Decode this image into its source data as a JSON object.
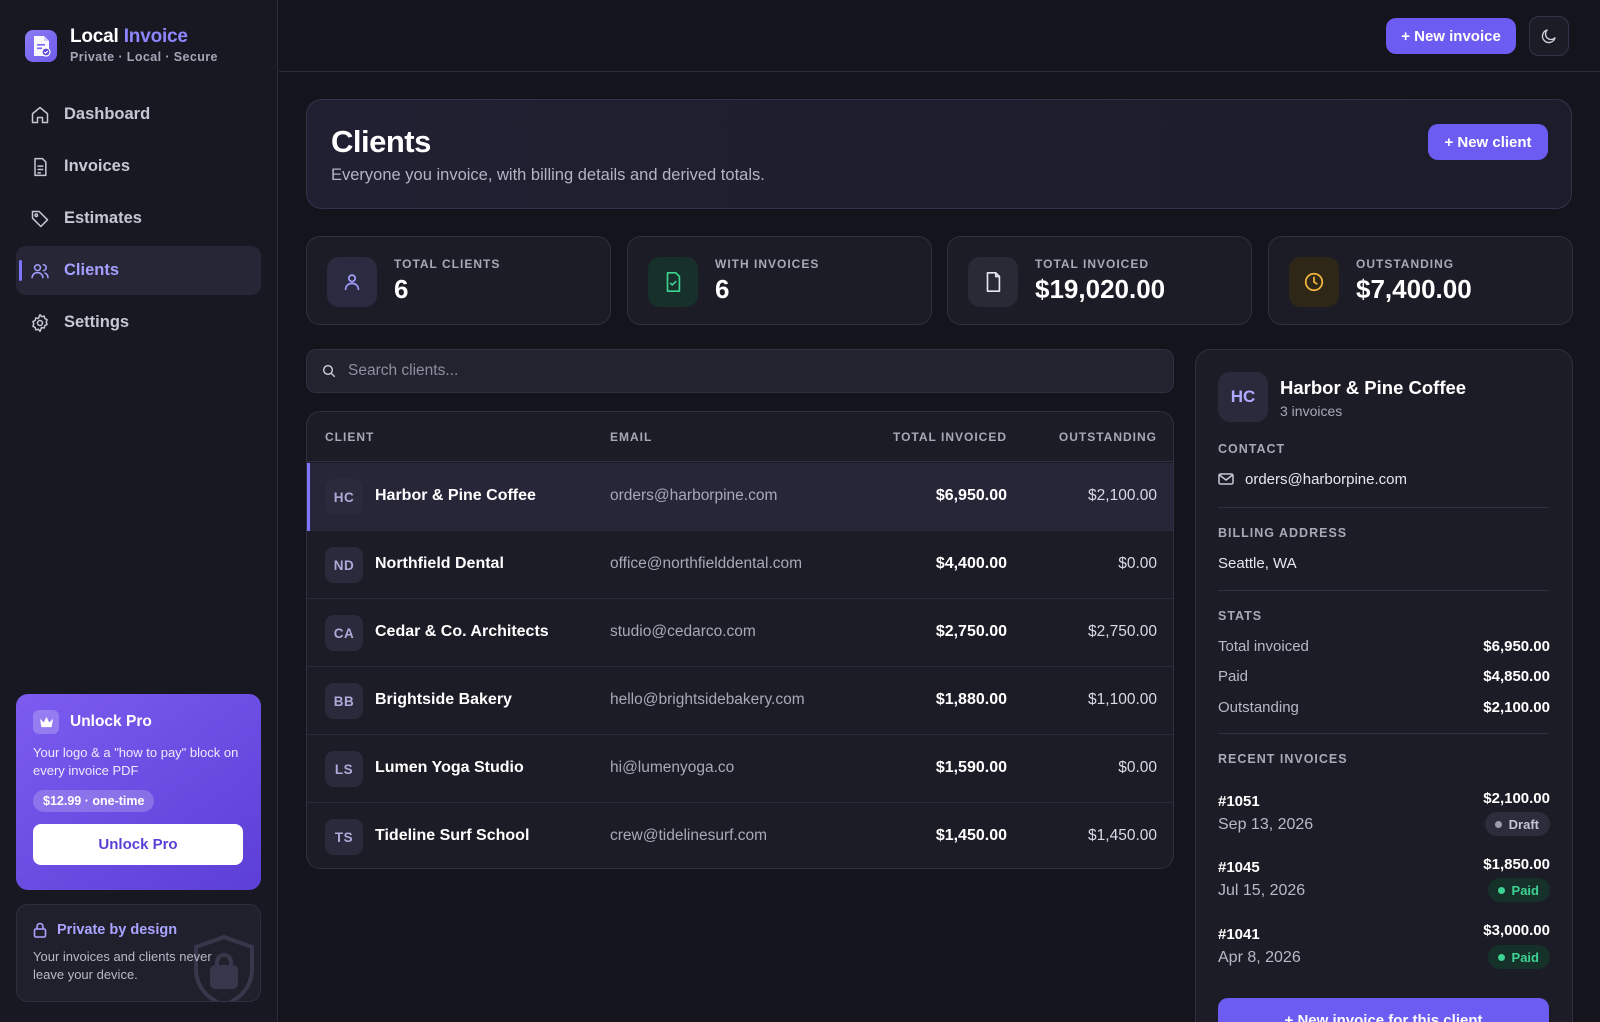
{
  "brand": {
    "name_main": "Local",
    "name_accent": "Invoice",
    "tagline": "Private · Local · Secure"
  },
  "nav": {
    "items": [
      {
        "label": "Dashboard",
        "icon": "home-icon"
      },
      {
        "label": "Invoices",
        "icon": "document-icon"
      },
      {
        "label": "Estimates",
        "icon": "tag-icon"
      },
      {
        "label": "Clients",
        "icon": "users-icon",
        "active": true
      },
      {
        "label": "Settings",
        "icon": "gear-icon"
      }
    ]
  },
  "pro": {
    "title": "Unlock Pro",
    "description": "Your logo & a \"how to pay\" block on every invoice PDF",
    "price": "$12.99 · one-time",
    "button": "Unlock Pro"
  },
  "privacy": {
    "title": "Private by design",
    "description": "Your invoices and clients never leave your device."
  },
  "topbar": {
    "new_invoice": "+ New invoice"
  },
  "header": {
    "title": "Clients",
    "subtitle": "Everyone you invoice, with billing details and derived totals.",
    "new_client": "+ New client"
  },
  "stats": [
    {
      "label": "TOTAL CLIENTS",
      "value": "6",
      "icon": "users-icon"
    },
    {
      "label": "WITH INVOICES",
      "value": "6",
      "icon": "document-check-icon"
    },
    {
      "label": "TOTAL INVOICED",
      "value": "$19,020.00",
      "icon": "document-icon"
    },
    {
      "label": "OUTSTANDING",
      "value": "$7,400.00",
      "icon": "clock-icon"
    }
  ],
  "search": {
    "placeholder": "Search clients..."
  },
  "table": {
    "columns": [
      "CLIENT",
      "EMAIL",
      "TOTAL INVOICED",
      "OUTSTANDING"
    ],
    "rows": [
      {
        "initials": "HC",
        "name": "Harbor & Pine Coffee",
        "email": "orders@harborpine.com",
        "total": "$6,950.00",
        "outstanding": "$2,100.00",
        "selected": true
      },
      {
        "initials": "ND",
        "name": "Northfield Dental",
        "email": "office@northfielddental.com",
        "total": "$4,400.00",
        "outstanding": "$0.00"
      },
      {
        "initials": "CA",
        "name": "Cedar & Co. Architects",
        "email": "studio@cedarco.com",
        "total": "$2,750.00",
        "outstanding": "$2,750.00"
      },
      {
        "initials": "BB",
        "name": "Brightside Bakery",
        "email": "hello@brightsidebakery.com",
        "total": "$1,880.00",
        "outstanding": "$1,100.00"
      },
      {
        "initials": "LS",
        "name": "Lumen Yoga Studio",
        "email": "hi@lumenyoga.co",
        "total": "$1,590.00",
        "outstanding": "$0.00"
      },
      {
        "initials": "TS",
        "name": "Tideline Surf School",
        "email": "crew@tidelinesurf.com",
        "total": "$1,450.00",
        "outstanding": "$1,450.00"
      }
    ]
  },
  "detail": {
    "initials": "HC",
    "name": "Harbor & Pine Coffee",
    "invoice_count": "3 invoices",
    "contact_heading": "CONTACT",
    "email": "orders@harborpine.com",
    "billing_heading": "BILLING ADDRESS",
    "billing_address": "Seattle, WA",
    "stats_heading": "STATS",
    "stats": [
      {
        "label": "Total invoiced",
        "value": "$6,950.00"
      },
      {
        "label": "Paid",
        "value": "$4,850.00"
      },
      {
        "label": "Outstanding",
        "value": "$2,100.00"
      }
    ],
    "recent_heading": "RECENT INVOICES",
    "recent": [
      {
        "number": "#1051",
        "date": "Sep 13, 2026",
        "amount": "$2,100.00",
        "status": "Draft"
      },
      {
        "number": "#1045",
        "date": "Jul 15, 2026",
        "amount": "$1,850.00",
        "status": "Paid"
      },
      {
        "number": "#1041",
        "date": "Apr 8, 2026",
        "amount": "$3,000.00",
        "status": "Paid"
      }
    ],
    "new_invoice_button": "+ New invoice for this client"
  },
  "colors": {
    "accent": "#6d5cf2",
    "background": "#14141c",
    "paid": "#3ed392"
  }
}
